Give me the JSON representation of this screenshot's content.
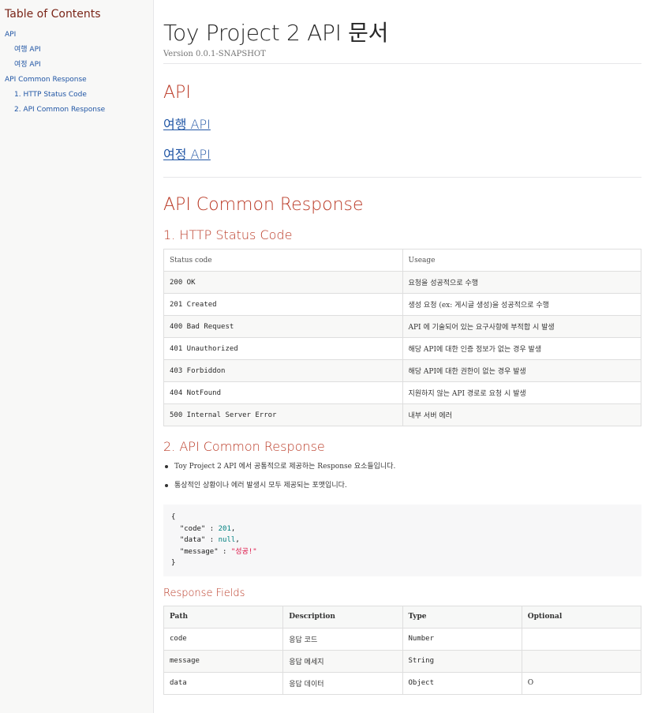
{
  "toc": {
    "title": "Table of Contents",
    "items": [
      {
        "label": "API",
        "level": 1
      },
      {
        "label": "여행 API",
        "level": 2
      },
      {
        "label": "여정 API",
        "level": 2
      },
      {
        "label": "API Common Response",
        "level": 1
      },
      {
        "label": "1. HTTP Status Code",
        "level": 2
      },
      {
        "label": "2. API Common Response",
        "level": 2
      }
    ]
  },
  "header": {
    "title": "Toy Project 2 API 문서",
    "version": "Version 0.0.1-SNAPSHOT"
  },
  "api_section": {
    "title": "API",
    "links": [
      "여행 API",
      "여정 API"
    ]
  },
  "common_section": {
    "title": "API Common Response",
    "status": {
      "title": "1. HTTP Status Code",
      "headers": [
        "Status code",
        "Useage"
      ],
      "rows": [
        [
          "200 OK",
          "요청을 성공적으로 수행"
        ],
        [
          "201 Created",
          "생성 요청 (ex: 게시글 생성)을 성공적으로 수행"
        ],
        [
          "400 Bad Request",
          "API 에 기술되어 있는 요구사항에 부적합 시 발생"
        ],
        [
          "401 Unauthorized",
          "해당 API에 대한 인증 정보가 없는 경우 발생"
        ],
        [
          "403 Forbiddon",
          "해당 API에 대한 권한이 없는 경우 발생"
        ],
        [
          "404 NotFound",
          "지원하지 않는 API 경로로 요청 시 발생"
        ],
        [
          "500 Internal Server Error",
          "내부 서버 에러"
        ]
      ]
    },
    "response": {
      "title": "2. API Common Response",
      "bullets": [
        "Toy Project 2 API 에서 공통적으로 제공하는 Response 요소들입니다.",
        "통상적인 상황이나 에러 발생시 모두 제공되는 포맷입니다."
      ],
      "code": {
        "open_brace": "{",
        "code_key": "\"code\"",
        "code_val": "201",
        "data_key": "\"data\"",
        "data_val": "null",
        "message_key": "\"message\"",
        "message_val": "\"성공!\"",
        "close_brace": "}"
      }
    },
    "fields": {
      "title": "Response Fields",
      "headers": [
        "Path",
        "Description",
        "Type",
        "Optional"
      ],
      "rows": [
        [
          "code",
          "응답 코드",
          "Number",
          ""
        ],
        [
          "message",
          "응답 메세지",
          "String",
          ""
        ],
        [
          "data",
          "응답 데이터",
          "Object",
          "O"
        ]
      ]
    }
  }
}
